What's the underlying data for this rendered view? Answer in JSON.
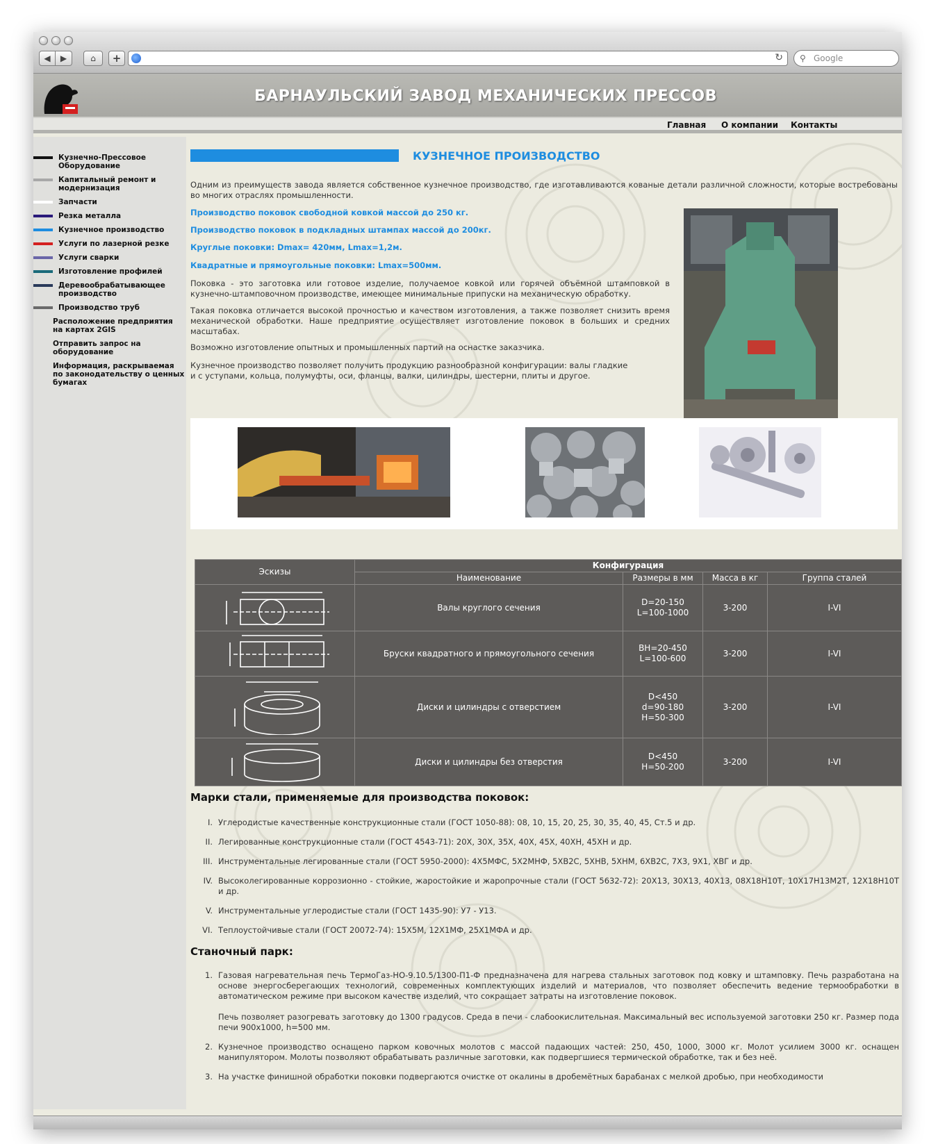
{
  "browser": {
    "search_placeholder": "Google",
    "url": ""
  },
  "header": {
    "title": "БАРНАУЛЬСКИЙ ЗАВОД МЕХАНИЧЕСКИХ ПРЕССОВ"
  },
  "topnav": {
    "home": "Главная",
    "about": "О компании",
    "contacts": "Контакты"
  },
  "sidebar": {
    "items": [
      {
        "label": "Кузнечно-Прессовое Оборудование",
        "color": "#111111"
      },
      {
        "label": "Капитальный ремонт и модернизация",
        "color": "#a8a8a8"
      },
      {
        "label": "Запчасти",
        "color": "#ffffff"
      },
      {
        "label": "Резка металла",
        "color": "#2a1a7a"
      },
      {
        "label": "Кузнечное производство",
        "color": "#1e8de0"
      },
      {
        "label": "Услуги по лазерной резке",
        "color": "#d42020"
      },
      {
        "label": "Услуги сварки",
        "color": "#6a66a8"
      },
      {
        "label": "Изготовление профилей",
        "color": "#1a6a7a"
      },
      {
        "label": "Деревообрабатывающее производство",
        "color": "#2a3a5a"
      },
      {
        "label": "Производство труб",
        "color": "#6a6a6a"
      }
    ],
    "links": [
      "Расположение предприятия на картах 2GIS",
      "Отправить запрос на оборудование",
      "Информация, раскрываемая по законодательству о ценных бумагах"
    ]
  },
  "main": {
    "title": "КУЗНЕЧНОЕ ПРОИЗВОДСТВО",
    "intro": "Одним из преимуществ завода является собственное кузнечное производство, где изготавливаются кованые детали различной сложности, которые востребованы во многих отраслях промышленности.",
    "highlights": [
      "Производство поковок свободной ковкой массой до 250 кг.",
      "Производство поковок в подкладных штампах массой до 200кг.",
      "Круглые поковки: Dmax= 420мм, Lmax=1,2м.",
      "Квадратные и прямоугольные поковки: Lmax=500мм."
    ],
    "paragraphs": [
      "Поковка - это заготовка или готовое изделие, получаемое ковкой или горячей объёмной штамповкой в кузнечно-штамповочном производстве, имеющее минимальные припуски на механическую обработку.",
      "Такая поковка отличается высокой прочностью и качеством изготовления, а также позволяет снизить время механической обработки. Наше предприятие осуществляет изготовление поковок в больших и средних масштабах.",
      "Возможно изготовление опытных и промышленных партий на оснастке заказчика.",
      "Кузнечное производство позволяет получить продукцию разнообразной конфигурации: валы гладкие и с уступами, кольца, полумуфты, оси, фланцы, валки, цилиндры, шестерни, плиты и другое."
    ]
  },
  "table": {
    "sketches": "Эскизы",
    "config": "Конфигурация",
    "cols": [
      "Наименование",
      "Размеры в мм",
      "Масса в кг",
      "Группа сталей"
    ],
    "rows": [
      {
        "name": "Валы круглого сечения",
        "size": "D=20-150\nL=100-1000",
        "mass": "3-200",
        "group": "I-VI"
      },
      {
        "name": "Бруски квадратного и прямоугольного сечения",
        "size": "BH=20-450\nL=100-600",
        "mass": "3-200",
        "group": "I-VI"
      },
      {
        "name": "Диски и цилиндры с отверстием",
        "size": "D<450\nd=90-180\nH=50-300",
        "mass": "3-200",
        "group": "I-VI"
      },
      {
        "name": "Диски и цилиндры без отверстия",
        "size": "D<450\nH=50-200",
        "mass": "3-200",
        "group": "I-VI"
      }
    ]
  },
  "steels": {
    "heading": "Марки стали, применяемые для производства поковок:",
    "items": [
      {
        "num": "I.",
        "text": "Углеродистые качественные конструкционные стали (ГОСТ 1050-88): 08, 10, 15, 20, 25, 30, 35, 40, 45, Ст.5 и др."
      },
      {
        "num": "II.",
        "text": "Легированные конструкционные стали (ГОСТ 4543-71): 20Х, 30Х, 35Х, 40Х, 45Х, 40ХН, 45ХН и др."
      },
      {
        "num": "III.",
        "text": "Инструментальные легированные стали (ГОСТ 5950-2000): 4Х5МФС, 5Х2МНФ, 5ХВ2С, 5ХНВ, 5ХНМ, 6ХВ2С, 7Х3, 9Х1, ХВГ и др."
      },
      {
        "num": "IV.",
        "text": "Высоколегированные коррозионно - стойкие, жаростойкие и жаропрочные стали (ГОСТ 5632-72): 20Х13, 30Х13, 40Х13, 08Х18Н10Т, 10Х17Н13М2Т, 12Х18Н10Т и др."
      },
      {
        "num": "V.",
        "text": "Инструментальные углеродистые стали (ГОСТ 1435-90): У7 - У13."
      },
      {
        "num": "VI.",
        "text": "Теплоустойчивые стали (ГОСТ 20072-74): 15Х5М, 12Х1МФ, 25Х1МФА и др."
      }
    ]
  },
  "park": {
    "heading": "Станочный парк:",
    "items": [
      {
        "num": "1.",
        "text": "Газовая нагревательная печь ТермоГаз-НО-9.10.5/1300-П1-Ф предназначена для нагрева стальных заготовок под ковку и штамповку. Печь разработана на основе энергосберегающих технологий, современных комплектующих изделий и материалов, что позволяет обеспечить ведение термообработки в автоматическом режиме при высоком качестве изделий, что сокращает затраты на изготовление поковок.",
        "extra": "Печь позволяет разогревать заготовку до 1300 градусов. Среда в печи - слабоокислительная. Максимальный вес используемой заготовки 250 кг. Размер пода печи 900х1000, h=500 мм."
      },
      {
        "num": "2.",
        "text": "Кузнечное производство оснащено парком ковочных молотов с массой падающих частей: 250, 450, 1000, 3000 кг. Молот усилием 3000 кг. оснащен манипулятором. Молоты позволяют обрабатывать различные заготовки, как подвергшиеся термической обработке, так и без неё."
      },
      {
        "num": "3.",
        "text": "На участке финишной обработки поковки подвергаются очистке от окалины в дробемётных барабанах с мелкой дробью, при необходимости"
      }
    ]
  }
}
